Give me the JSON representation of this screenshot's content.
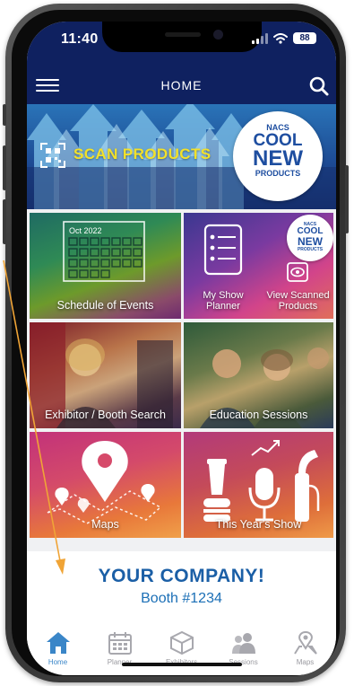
{
  "status_bar": {
    "time": "11:40",
    "battery": "88"
  },
  "header": {
    "title": "HOME"
  },
  "scan_banner": {
    "label": "SCAN PRODUCTS",
    "badge": {
      "line1": "NACS",
      "line2": "COOL",
      "line3": "NEW",
      "line4": "PRODUCTS"
    }
  },
  "tiles": {
    "schedule": {
      "label": "Schedule of Events",
      "calendar_month": "Oct 2022"
    },
    "my_show_planner": {
      "label": "My Show Planner"
    },
    "view_scanned": {
      "label": "View Scanned Products",
      "badge": {
        "line1": "NACS",
        "line2": "COOL",
        "line3": "NEW",
        "line4": "PRODUCTS"
      }
    },
    "exhibitor": {
      "label": "Exhibitor / Booth Search"
    },
    "education": {
      "label": "Education Sessions"
    },
    "maps": {
      "label": "Maps"
    },
    "this_years_show": {
      "label": "This Year's Show"
    }
  },
  "company": {
    "name": "YOUR COMPANY!",
    "booth": "Booth #1234"
  },
  "tab_bar": {
    "items": [
      {
        "label": "Home",
        "icon": "home-icon",
        "active": true
      },
      {
        "label": "Planner",
        "icon": "calendar-icon",
        "active": false
      },
      {
        "label": "Exhibitors",
        "icon": "box-icon",
        "active": false
      },
      {
        "label": "Sessions",
        "icon": "people-icon",
        "active": false
      },
      {
        "label": "Maps",
        "icon": "map-pin-icon",
        "active": false
      }
    ]
  },
  "colors": {
    "header_bg": "#0f2160",
    "scan_label": "#f2e12a",
    "company_text": "#1b5fa6",
    "tab_active": "#3a86c8",
    "annotation_arrow": "#f0a436"
  }
}
